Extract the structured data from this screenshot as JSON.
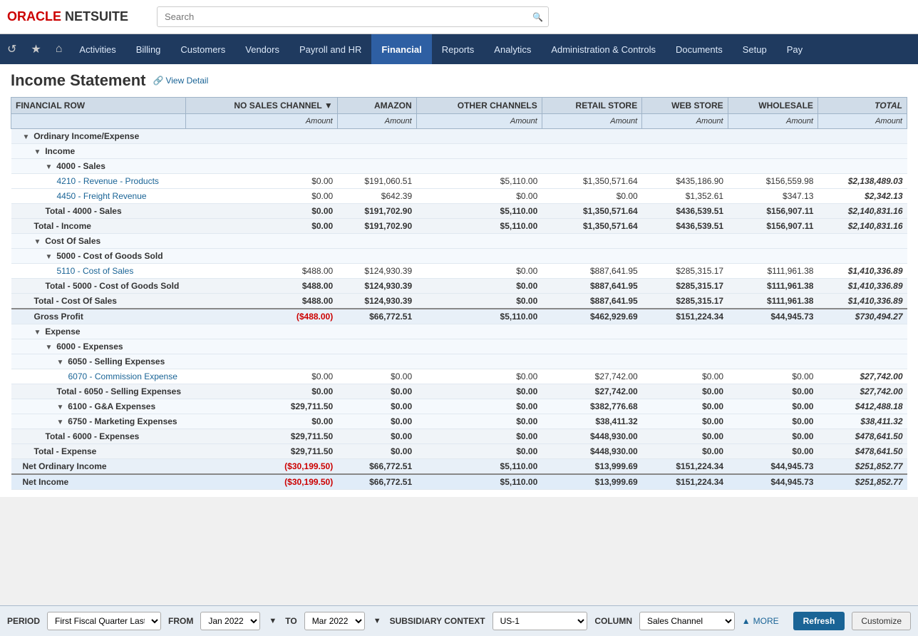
{
  "logo": {
    "text": "ORACLE NETSUITE"
  },
  "search": {
    "placeholder": "Search"
  },
  "nav": {
    "icons": [
      {
        "name": "history-icon",
        "glyph": "↺"
      },
      {
        "name": "star-icon",
        "glyph": "★"
      },
      {
        "name": "home-icon",
        "glyph": "⌂"
      }
    ],
    "items": [
      {
        "label": "Activities",
        "active": false
      },
      {
        "label": "Billing",
        "active": false
      },
      {
        "label": "Customers",
        "active": false
      },
      {
        "label": "Vendors",
        "active": false
      },
      {
        "label": "Payroll and HR",
        "active": false
      },
      {
        "label": "Financial",
        "active": true
      },
      {
        "label": "Reports",
        "active": false
      },
      {
        "label": "Analytics",
        "active": false
      },
      {
        "label": "Administration & Controls",
        "active": false
      },
      {
        "label": "Documents",
        "active": false
      },
      {
        "label": "Setup",
        "active": false
      },
      {
        "label": "Pay",
        "active": false
      }
    ]
  },
  "page": {
    "title": "Income Statement",
    "view_detail": "View Detail"
  },
  "table": {
    "columns": [
      {
        "id": "row",
        "label": "FINANCIAL ROW",
        "sub": ""
      },
      {
        "id": "no_sales",
        "label": "NO SALES CHANNEL",
        "sub": "Amount"
      },
      {
        "id": "amazon",
        "label": "AMAZON",
        "sub": "Amount"
      },
      {
        "id": "other",
        "label": "OTHER CHANNELS",
        "sub": "Amount"
      },
      {
        "id": "retail",
        "label": "RETAIL STORE",
        "sub": "Amount"
      },
      {
        "id": "web",
        "label": "WEB STORE",
        "sub": "Amount"
      },
      {
        "id": "wholesale",
        "label": "WHOLESALE",
        "sub": "Amount"
      },
      {
        "id": "total",
        "label": "TOTAL",
        "sub": "Amount"
      }
    ],
    "rows": [
      {
        "type": "section-header",
        "indent": 1,
        "collapse": true,
        "label": "Ordinary Income/Expense",
        "no_sales": "",
        "amazon": "",
        "other": "",
        "retail": "",
        "web": "",
        "wholesale": "",
        "total": ""
      },
      {
        "type": "sub-section-header",
        "indent": 2,
        "collapse": true,
        "label": "Income",
        "no_sales": "",
        "amazon": "",
        "other": "",
        "retail": "",
        "web": "",
        "wholesale": "",
        "total": ""
      },
      {
        "type": "sub-section-header",
        "indent": 3,
        "collapse": true,
        "label": "4000 - Sales",
        "no_sales": "",
        "amazon": "",
        "other": "",
        "retail": "",
        "web": "",
        "wholesale": "",
        "total": ""
      },
      {
        "type": "data-row",
        "indent": 4,
        "label": "4210 - Revenue - Products",
        "no_sales": "$0.00",
        "amazon": "$191,060.51",
        "other": "$5,110.00",
        "retail": "$1,350,571.64",
        "web": "$435,186.90",
        "wholesale": "$156,559.98",
        "total": "$2,138,489.03"
      },
      {
        "type": "data-row",
        "indent": 4,
        "label": "4450 - Freight Revenue",
        "no_sales": "$0.00",
        "amazon": "$642.39",
        "other": "$0.00",
        "retail": "$0.00",
        "web": "$1,352.61",
        "wholesale": "$347.13",
        "total": "$2,342.13"
      },
      {
        "type": "total-row",
        "indent": 3,
        "label": "Total - 4000 - Sales",
        "no_sales": "$0.00",
        "amazon": "$191,702.90",
        "other": "$5,110.00",
        "retail": "$1,350,571.64",
        "web": "$436,539.51",
        "wholesale": "$156,907.11",
        "total": "$2,140,831.16"
      },
      {
        "type": "total-row",
        "indent": 2,
        "label": "Total - Income",
        "no_sales": "$0.00",
        "amazon": "$191,702.90",
        "other": "$5,110.00",
        "retail": "$1,350,571.64",
        "web": "$436,539.51",
        "wholesale": "$156,907.11",
        "total": "$2,140,831.16"
      },
      {
        "type": "sub-section-header",
        "indent": 2,
        "collapse": true,
        "label": "Cost Of Sales",
        "no_sales": "",
        "amazon": "",
        "other": "",
        "retail": "",
        "web": "",
        "wholesale": "",
        "total": ""
      },
      {
        "type": "sub-section-header",
        "indent": 3,
        "collapse": true,
        "label": "5000 - Cost of Goods Sold",
        "no_sales": "",
        "amazon": "",
        "other": "",
        "retail": "",
        "web": "",
        "wholesale": "",
        "total": ""
      },
      {
        "type": "data-row",
        "indent": 4,
        "label": "5110 - Cost of Sales",
        "no_sales": "$488.00",
        "amazon": "$124,930.39",
        "other": "$0.00",
        "retail": "$887,641.95",
        "web": "$285,315.17",
        "wholesale": "$111,961.38",
        "total": "$1,410,336.89"
      },
      {
        "type": "total-row",
        "indent": 3,
        "label": "Total - 5000 - Cost of Goods Sold",
        "no_sales": "$488.00",
        "amazon": "$124,930.39",
        "other": "$0.00",
        "retail": "$887,641.95",
        "web": "$285,315.17",
        "wholesale": "$111,961.38",
        "total": "$1,410,336.89"
      },
      {
        "type": "total-row",
        "indent": 2,
        "label": "Total - Cost Of Sales",
        "no_sales": "$488.00",
        "amazon": "$124,930.39",
        "other": "$0.00",
        "retail": "$887,641.95",
        "web": "$285,315.17",
        "wholesale": "$111,961.38",
        "total": "$1,410,336.89"
      },
      {
        "type": "gross-profit-row",
        "indent": 2,
        "label": "Gross Profit",
        "no_sales": "($488.00)",
        "amazon": "$66,772.51",
        "other": "$5,110.00",
        "retail": "$462,929.69",
        "web": "$151,224.34",
        "wholesale": "$44,945.73",
        "total": "$730,494.27"
      },
      {
        "type": "sub-section-header",
        "indent": 2,
        "collapse": true,
        "label": "Expense",
        "no_sales": "",
        "amazon": "",
        "other": "",
        "retail": "",
        "web": "",
        "wholesale": "",
        "total": ""
      },
      {
        "type": "sub-section-header",
        "indent": 3,
        "collapse": true,
        "label": "6000 - Expenses",
        "no_sales": "",
        "amazon": "",
        "other": "",
        "retail": "",
        "web": "",
        "wholesale": "",
        "total": ""
      },
      {
        "type": "sub-section-header",
        "indent": 4,
        "collapse": true,
        "label": "6050 - Selling Expenses",
        "no_sales": "",
        "amazon": "",
        "other": "",
        "retail": "",
        "web": "",
        "wholesale": "",
        "total": ""
      },
      {
        "type": "data-row",
        "indent": 5,
        "label": "6070 - Commission Expense",
        "no_sales": "$0.00",
        "amazon": "$0.00",
        "other": "$0.00",
        "retail": "$27,742.00",
        "web": "$0.00",
        "wholesale": "$0.00",
        "total": "$27,742.00"
      },
      {
        "type": "total-row",
        "indent": 4,
        "label": "Total - 6050 - Selling Expenses",
        "no_sales": "$0.00",
        "amazon": "$0.00",
        "other": "$0.00",
        "retail": "$27,742.00",
        "web": "$0.00",
        "wholesale": "$0.00",
        "total": "$27,742.00"
      },
      {
        "type": "sub-section-header",
        "indent": 4,
        "collapse": true,
        "label": "6100 - G&A Expenses",
        "no_sales": "$29,711.50",
        "amazon": "$0.00",
        "other": "$0.00",
        "retail": "$382,776.68",
        "web": "$0.00",
        "wholesale": "$0.00",
        "total": "$412,488.18"
      },
      {
        "type": "sub-section-header",
        "indent": 4,
        "collapse": true,
        "label": "6750 - Marketing Expenses",
        "no_sales": "$0.00",
        "amazon": "$0.00",
        "other": "$0.00",
        "retail": "$38,411.32",
        "web": "$0.00",
        "wholesale": "$0.00",
        "total": "$38,411.32"
      },
      {
        "type": "total-row",
        "indent": 3,
        "label": "Total - 6000 - Expenses",
        "no_sales": "$29,711.50",
        "amazon": "$0.00",
        "other": "$0.00",
        "retail": "$448,930.00",
        "web": "$0.00",
        "wholesale": "$0.00",
        "total": "$478,641.50"
      },
      {
        "type": "total-row",
        "indent": 2,
        "label": "Total - Expense",
        "no_sales": "$29,711.50",
        "amazon": "$0.00",
        "other": "$0.00",
        "retail": "$448,930.00",
        "web": "$0.00",
        "wholesale": "$0.00",
        "total": "$478,641.50"
      },
      {
        "type": "net-ordinary-row",
        "indent": 1,
        "label": "Net Ordinary Income",
        "no_sales": "($30,199.50)",
        "amazon": "$66,772.51",
        "other": "$5,110.00",
        "retail": "$13,999.69",
        "web": "$151,224.34",
        "wholesale": "$44,945.73",
        "total": "$251,852.77"
      },
      {
        "type": "net-income-row",
        "indent": 1,
        "label": "Net Income",
        "no_sales": "($30,199.50)",
        "amazon": "$66,772.51",
        "other": "$5,110.00",
        "retail": "$13,999.69",
        "web": "$151,224.34",
        "wholesale": "$44,945.73",
        "total": "$251,852.77"
      }
    ]
  },
  "bottom": {
    "period_label": "PERIOD",
    "period_value": "First Fiscal Quarter Last F",
    "from_label": "FROM",
    "from_value": "Jan 2022",
    "to_label": "TO",
    "to_value": "Mar 2022",
    "subsidiary_label": "SUBSIDIARY CONTEXT",
    "subsidiary_value": "US-1",
    "column_label": "COLUMN",
    "column_value": "Sales Channel",
    "more_label": "MORE",
    "refresh_label": "Refresh",
    "customize_label": "Customize"
  }
}
